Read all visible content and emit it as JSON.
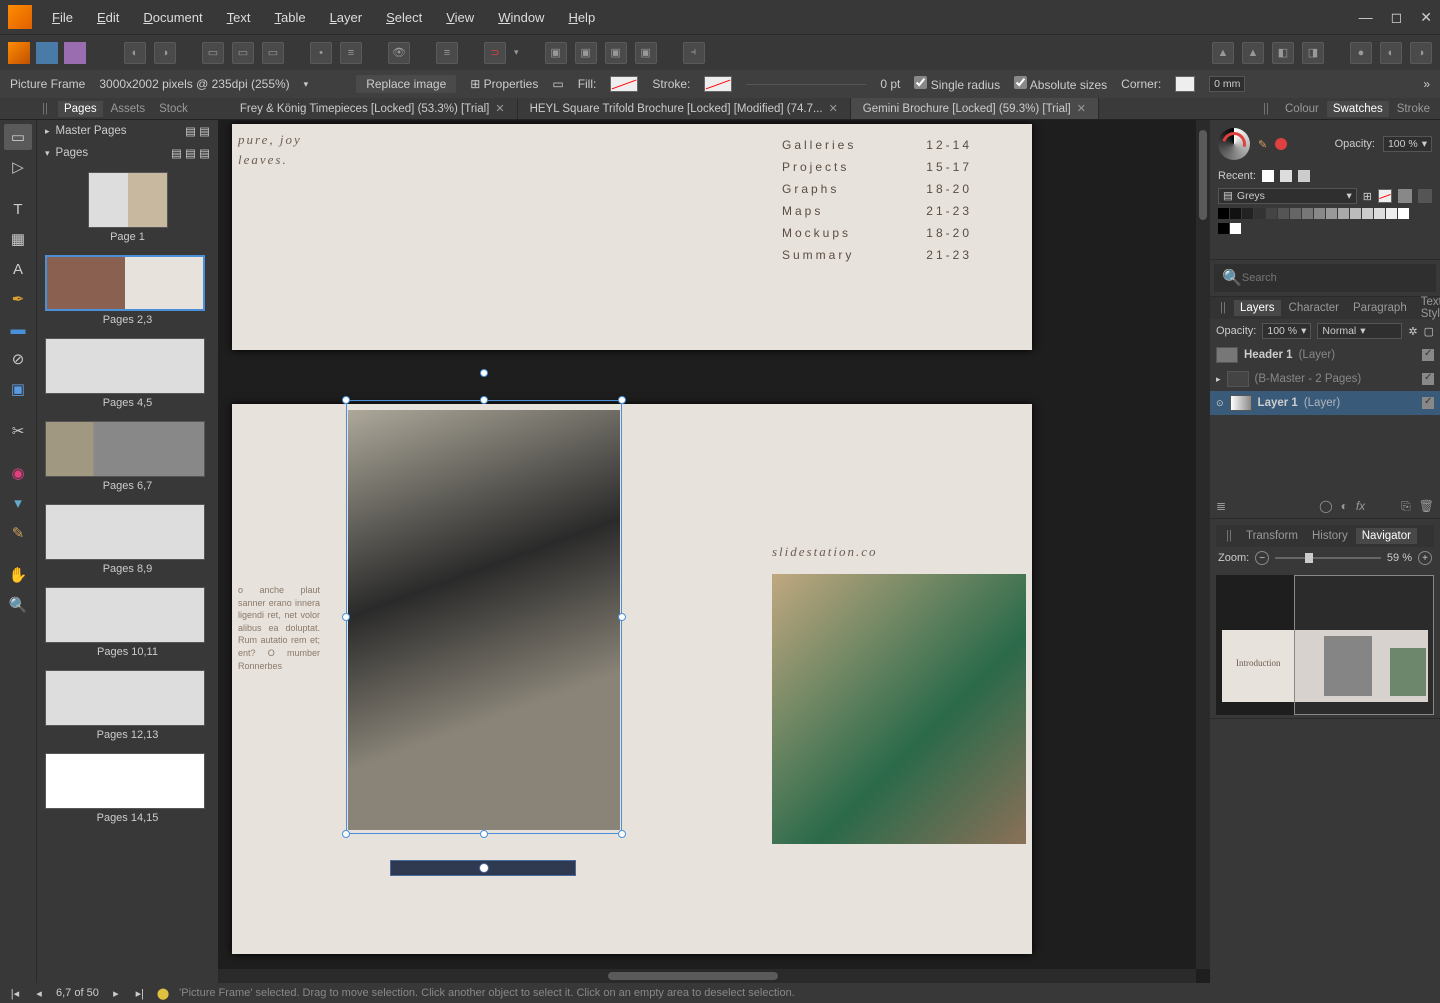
{
  "menu": {
    "file": "File",
    "edit": "Edit",
    "document": "Document",
    "text": "Text",
    "table": "Table",
    "layer": "Layer",
    "select": "Select",
    "view": "View",
    "window": "Window",
    "help": "Help"
  },
  "context": {
    "tool": "Picture Frame",
    "dims": "3000x2002 pixels @ 235dpi (255%)",
    "replace": "Replace image",
    "properties": "Properties",
    "fill_label": "Fill:",
    "stroke_label": "Stroke:",
    "stroke_pt": "0 pt",
    "single_radius": "Single radius",
    "absolute_sizes": "Absolute sizes",
    "corner_label": "Corner:",
    "corner_val": "0 mm"
  },
  "doctabs": [
    {
      "title": "Frey & König Timepieces [Locked] (53.3%) [Trial]",
      "active": false
    },
    {
      "title": "HEYL Square Trifold Brochure [Locked] [Modified] (74.7...",
      "active": false
    },
    {
      "title": "Gemini Brochure [Locked] (59.3%) [Trial]",
      "active": true
    }
  ],
  "left": {
    "tabs": {
      "pages": "Pages",
      "assets": "Assets",
      "stock": "Stock"
    },
    "master": "Master Pages",
    "pages_label": "Pages",
    "thumbs": [
      {
        "label": "Page 1",
        "single": true
      },
      {
        "label": "Pages 2,3",
        "sel": true
      },
      {
        "label": "Pages 4,5"
      },
      {
        "label": "Pages 6,7"
      },
      {
        "label": "Pages 8,9"
      },
      {
        "label": "Pages 10,11"
      },
      {
        "label": "Pages 12,13"
      },
      {
        "label": "Pages 14,15"
      }
    ]
  },
  "canvas": {
    "italic1": "pure, joy",
    "italic2": "leaves.",
    "toc": [
      {
        "k": "Galleries",
        "v": "12-14"
      },
      {
        "k": "Projects",
        "v": "15-17"
      },
      {
        "k": "Graphs",
        "v": "18-20"
      },
      {
        "k": "Maps",
        "v": "21-23"
      },
      {
        "k": "Mockups",
        "v": "18-20"
      },
      {
        "k": "Summary",
        "v": "21-23"
      }
    ],
    "lorem": "o anche plaut sanner erano innera ligendi ret, net volor alibus ea doluptat. Rum autatio rem et; ent? O mumber Ronnerbes",
    "url": "slidestation.co",
    "intro": "Introduction"
  },
  "right": {
    "colour_tabs": {
      "colour": "Colour",
      "swatches": "Swatches",
      "stroke": "Stroke"
    },
    "opacity_label": "Opacity:",
    "opacity_val": "100 %",
    "recent": "Recent:",
    "greys": "Greys",
    "search_ph": "Search",
    "layer_tabs": {
      "layers": "Layers",
      "character": "Character",
      "paragraph": "Paragraph",
      "textstyles": "Text Styles"
    },
    "layer_opacity": "Opacity:",
    "layer_op_val": "100 %",
    "blend": "Normal",
    "layers": [
      {
        "name": "Header 1",
        "suffix": "(Layer)"
      },
      {
        "name": "(B-Master - 2 Pages)",
        "suffix": ""
      },
      {
        "name": "Layer 1",
        "suffix": "(Layer)",
        "sel": true
      }
    ],
    "nav_tabs": {
      "transform": "Transform",
      "history": "History",
      "navigator": "Navigator"
    },
    "zoom_label": "Zoom:",
    "zoom_val": "59 %"
  },
  "status": {
    "page": "6,7 of 50",
    "hint": "'Picture Frame' selected. Drag to move selection. Click another object to select it. Click on an empty area to deselect selection."
  }
}
